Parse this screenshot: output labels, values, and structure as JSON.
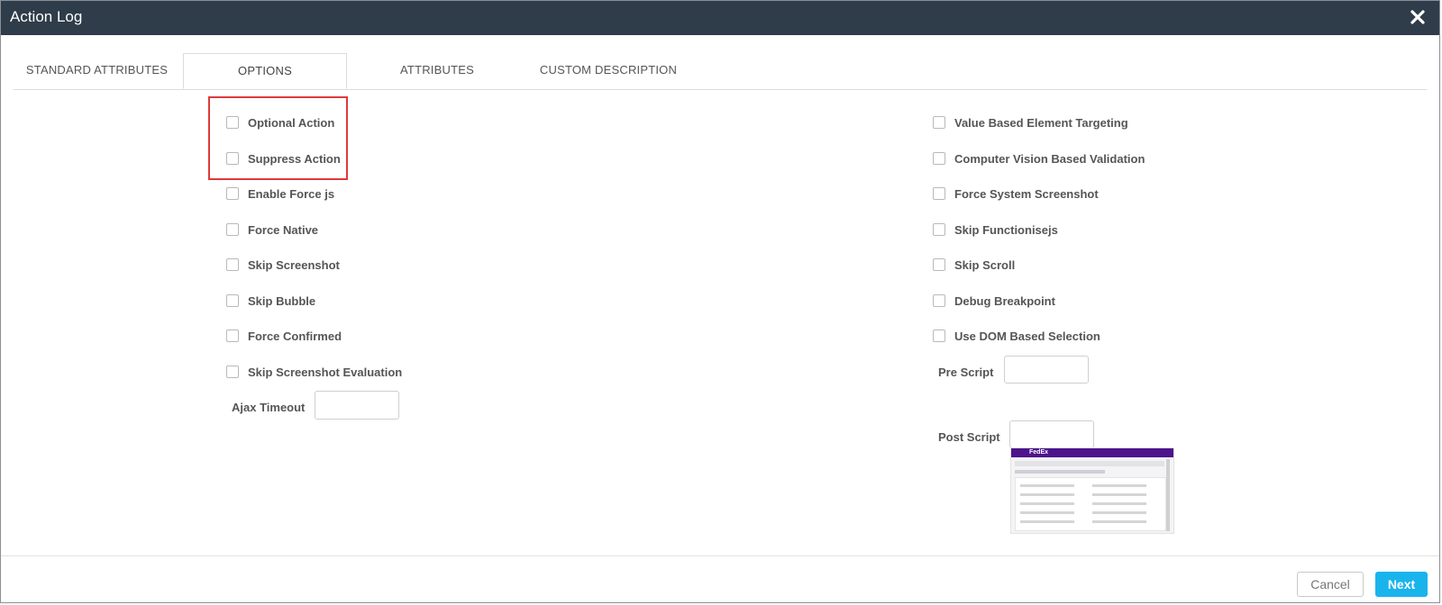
{
  "window": {
    "title": "Action Log"
  },
  "tabs": [
    {
      "label": "STANDARD ATTRIBUTES"
    },
    {
      "label": "OPTIONS"
    },
    {
      "label": "ATTRIBUTES"
    },
    {
      "label": "CUSTOM DESCRIPTION"
    }
  ],
  "left_options": [
    {
      "label": "Optional Action"
    },
    {
      "label": "Suppress Action"
    },
    {
      "label": "Enable Force js"
    },
    {
      "label": "Force Native"
    },
    {
      "label": "Skip Screenshot"
    },
    {
      "label": "Skip Bubble"
    },
    {
      "label": "Force Confirmed"
    },
    {
      "label": "Skip Screenshot Evaluation"
    }
  ],
  "right_options": [
    {
      "label": "Value Based Element Targeting"
    },
    {
      "label": "Computer Vision Based Validation"
    },
    {
      "label": "Force System Screenshot"
    },
    {
      "label": "Skip Functionisejs"
    },
    {
      "label": "Skip Scroll"
    },
    {
      "label": "Debug Breakpoint"
    },
    {
      "label": "Use DOM Based Selection"
    }
  ],
  "fields": {
    "ajax_timeout": {
      "label": "Ajax Timeout",
      "value": ""
    },
    "pre_script": {
      "label": "Pre Script",
      "value": ""
    },
    "post_script": {
      "label": "Post Script",
      "value": ""
    }
  },
  "buttons": {
    "cancel": "Cancel",
    "next": "Next"
  },
  "colors": {
    "titlebar": "#2f3c49",
    "accent": "#1ab4ec",
    "highlight": "#e0393a"
  },
  "thumbnail": {
    "brand": "FedEx"
  }
}
